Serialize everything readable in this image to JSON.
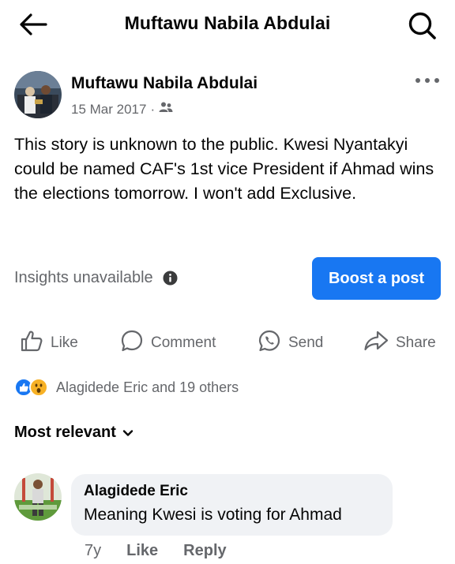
{
  "header": {
    "title": "Muftawu Nabila Abdulai",
    "back_icon": "arrow-left-icon",
    "search_icon": "search-icon"
  },
  "post": {
    "author": "Muftawu Nabila Abdulai",
    "date": "15 Mar 2017",
    "separator": "·",
    "audience_icon": "friends-icon",
    "more_icon": "more-horizontal-icon",
    "text": "This story is unknown to the public. Kwesi Nyantakyi could be named CAF's 1st vice President if Ahmad wins the elections tomorrow. I won't add Exclusive."
  },
  "insights": {
    "label": "Insights unavailable",
    "info_icon": "info-icon"
  },
  "boost": {
    "label": "Boost a post",
    "color": "#1877f2"
  },
  "actions": {
    "like": "Like",
    "comment": "Comment",
    "send": "Send",
    "share": "Share"
  },
  "reactions": {
    "types": [
      "like",
      "wow"
    ],
    "summary": "Alagidede Eric and 19 others"
  },
  "comments_sort": {
    "label": "Most relevant"
  },
  "comments": [
    {
      "author": "Alagidede Eric",
      "text": "Meaning Kwesi is voting for Ahmad",
      "age": "7y",
      "like_label": "Like",
      "reply_label": "Reply"
    }
  ],
  "colors": {
    "accent": "#1877f2",
    "secondary_text": "#65676b",
    "bubble_bg": "#f0f2f5"
  }
}
